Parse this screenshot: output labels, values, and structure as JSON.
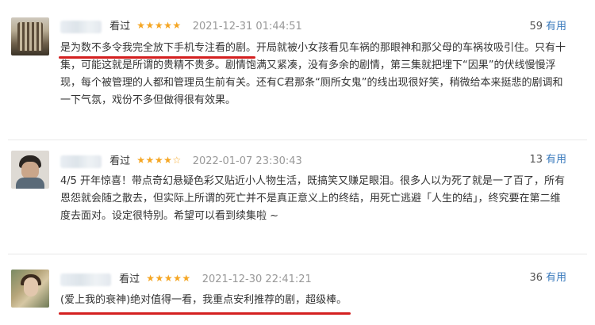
{
  "reviews": [
    {
      "watched_label": "看过",
      "stars": "★★★★★",
      "time": "2021-12-31 01:44:51",
      "useful_count": "59",
      "useful_label": "有用",
      "content_highlight": "是为数不多令我完全放下手机专注看的剧。",
      "content_rest": "开局就被小女孩看见车祸的那眼神和那父母的车祸妆吸引住。只有十集，可能这就是所谓的贵精不贵多。剧情饱满又紧凑，没有多余的剧情，第三集就把埋下“因果”的伏线慢慢浮现，每个被管理的人都和管理员生前有关。还有C君那条“厕所女鬼”的线出现很好笑，稍微给本来挺悲的剧调和一下气氛，戏份不多但做得很有效果。"
    },
    {
      "watched_label": "看过",
      "stars": "★★★★☆",
      "time": "2022-01-07 23:30:43",
      "useful_count": "13",
      "useful_label": "有用",
      "content": "4/5 开年惊喜！带点奇幻悬疑色彩又贴近小人物生活，既搞笑又赚足眼泪。很多人以为死了就是一了百了，所有恩怨就会随之散去，但实际上所谓的死亡并不是真正意义上的终结，用死亡逃避「人生的结」，终究要在第二维度去面对。设定很特别。希望可以看到续集啦 ~"
    },
    {
      "watched_label": "看过",
      "stars": "★★★★★",
      "time": "2021-12-30 22:41:21",
      "useful_count": "36",
      "useful_label": "有用",
      "content": "(爱上我的衰神)绝对值得一看，我重点安利推荐的剧，超级棒。"
    }
  ],
  "colors": {
    "star": "#f5a623",
    "link": "#3b7bbd",
    "highlight_line": "#d42020"
  }
}
